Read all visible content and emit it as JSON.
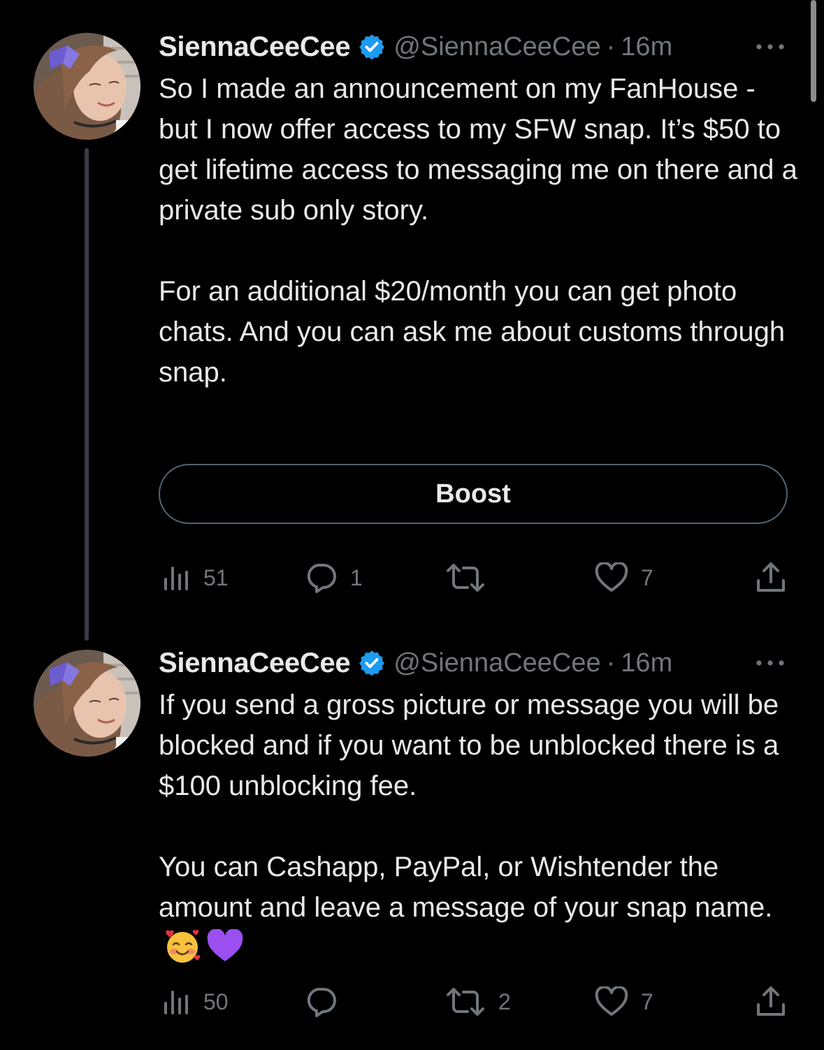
{
  "tweets": [
    {
      "display_name": "SiennaCeeCee",
      "handle": "@SiennaCeeCee",
      "separator": "·",
      "timestamp": "16m",
      "paragraphs": [
        "So I made an announcement on my FanHouse - but I now offer access to my SFW snap. It’s $50 to get lifetime access to messaging me on there and a private sub only story.",
        "For an additional $20/month you can get photo chats. And you can ask me about customs through snap."
      ],
      "boost_label": "Boost",
      "stats": {
        "views": "51",
        "replies": "1",
        "retweets": "",
        "likes": "7"
      }
    },
    {
      "display_name": "SiennaCeeCee",
      "handle": "@SiennaCeeCee",
      "separator": "·",
      "timestamp": "16m",
      "paragraphs": [
        "If you send a gross picture or message you will be blocked and if you want to be unblocked there is a $100 unblocking fee.",
        "You can Cashapp, PayPal, or Wishtender the amount and leave a message of your snap name."
      ],
      "emojis": [
        "smiling-face-with-hearts",
        "purple-heart"
      ],
      "stats": {
        "views": "50",
        "replies": "",
        "retweets": "2",
        "likes": "7"
      }
    }
  ],
  "icons": {
    "verified": "verified-badge-icon",
    "more": "more-options-icon",
    "views": "analytics-icon",
    "reply": "reply-icon",
    "retweet": "retweet-icon",
    "like": "like-icon",
    "share": "share-icon"
  },
  "colors": {
    "background": "#000000",
    "primary_text": "#e7e9ea",
    "secondary_text": "#71767b",
    "verified_blue": "#1d9bf0",
    "border": "#536471",
    "thread_line": "#3a3d41"
  }
}
